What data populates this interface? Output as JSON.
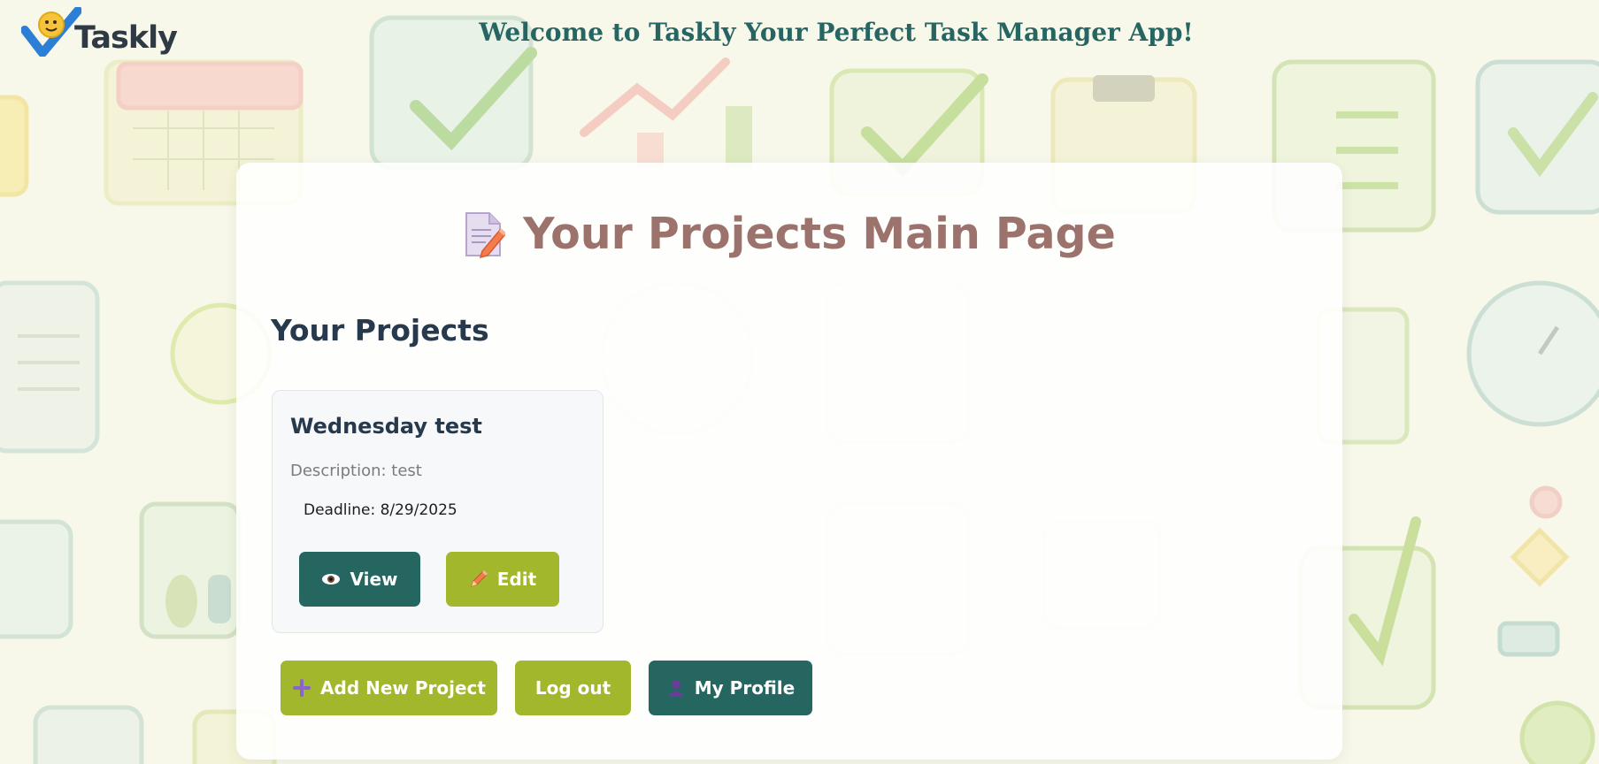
{
  "header": {
    "logo_text": "Taskly",
    "welcome": "Welcome to Taskly Your Perfect Task Manager App!"
  },
  "main": {
    "title": "Your Projects Main Page",
    "section_title": "Your Projects",
    "projects": [
      {
        "name": "Wednesday test",
        "description": "Description: test",
        "deadline": "Deadline: 8/29/2025",
        "view_label": "View",
        "edit_label": "Edit"
      }
    ]
  },
  "actions": {
    "add_label": "Add New Project",
    "logout_label": "Log out",
    "profile_label": "My Profile"
  },
  "icons": {
    "title_icon": "memo-icon",
    "view_icon": "eye-icon",
    "edit_icon": "pencil-icon",
    "add_icon": "plus-icon",
    "profile_icon": "user-icon"
  },
  "colors": {
    "teal": "#266661",
    "olive": "#a2b72b",
    "title": "#9c726c",
    "heading": "#26394d",
    "welcome": "#276562"
  }
}
